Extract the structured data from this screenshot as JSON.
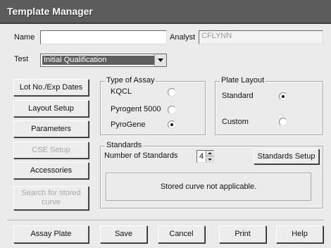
{
  "window": {
    "title": "Template Manager"
  },
  "form": {
    "name_label": "Name",
    "name_value": "",
    "analyst_label": "Analyst",
    "analyst_value": "CFLYNN",
    "test_label": "Test",
    "test_value": "Initial Qualification"
  },
  "left_buttons": {
    "lot_exp": "Lot No./Exp Dates",
    "layout_setup": "Layout Setup",
    "parameters": "Parameters",
    "cse_setup": "CSE Setup",
    "accessories": "Accessories",
    "search_curve": "Search for stored curve"
  },
  "type_of_assay": {
    "legend": "Type of Assay",
    "options": [
      {
        "label": "KQCL",
        "selected": false
      },
      {
        "label": "Pyrogent 5000",
        "selected": false
      },
      {
        "label": "PyroGene",
        "selected": true
      }
    ]
  },
  "plate_layout": {
    "legend": "Plate Layout",
    "options": [
      {
        "label": "Standard",
        "selected": true
      },
      {
        "label": "Custom",
        "selected": false
      }
    ]
  },
  "standards": {
    "legend": "Standards",
    "number_label": "Number of Standards",
    "number_value": "4",
    "setup_button": "Standards Setup",
    "message": "Stored curve not applicable."
  },
  "bottom_buttons": {
    "assay_plate": "Assay Plate",
    "save": "Save",
    "cancel": "Cancel",
    "print": "Print",
    "help": "Help"
  },
  "colors": {
    "titlebar": "#5c5c5c",
    "selection": "#5e5e5e",
    "face": "#ebebeb"
  }
}
